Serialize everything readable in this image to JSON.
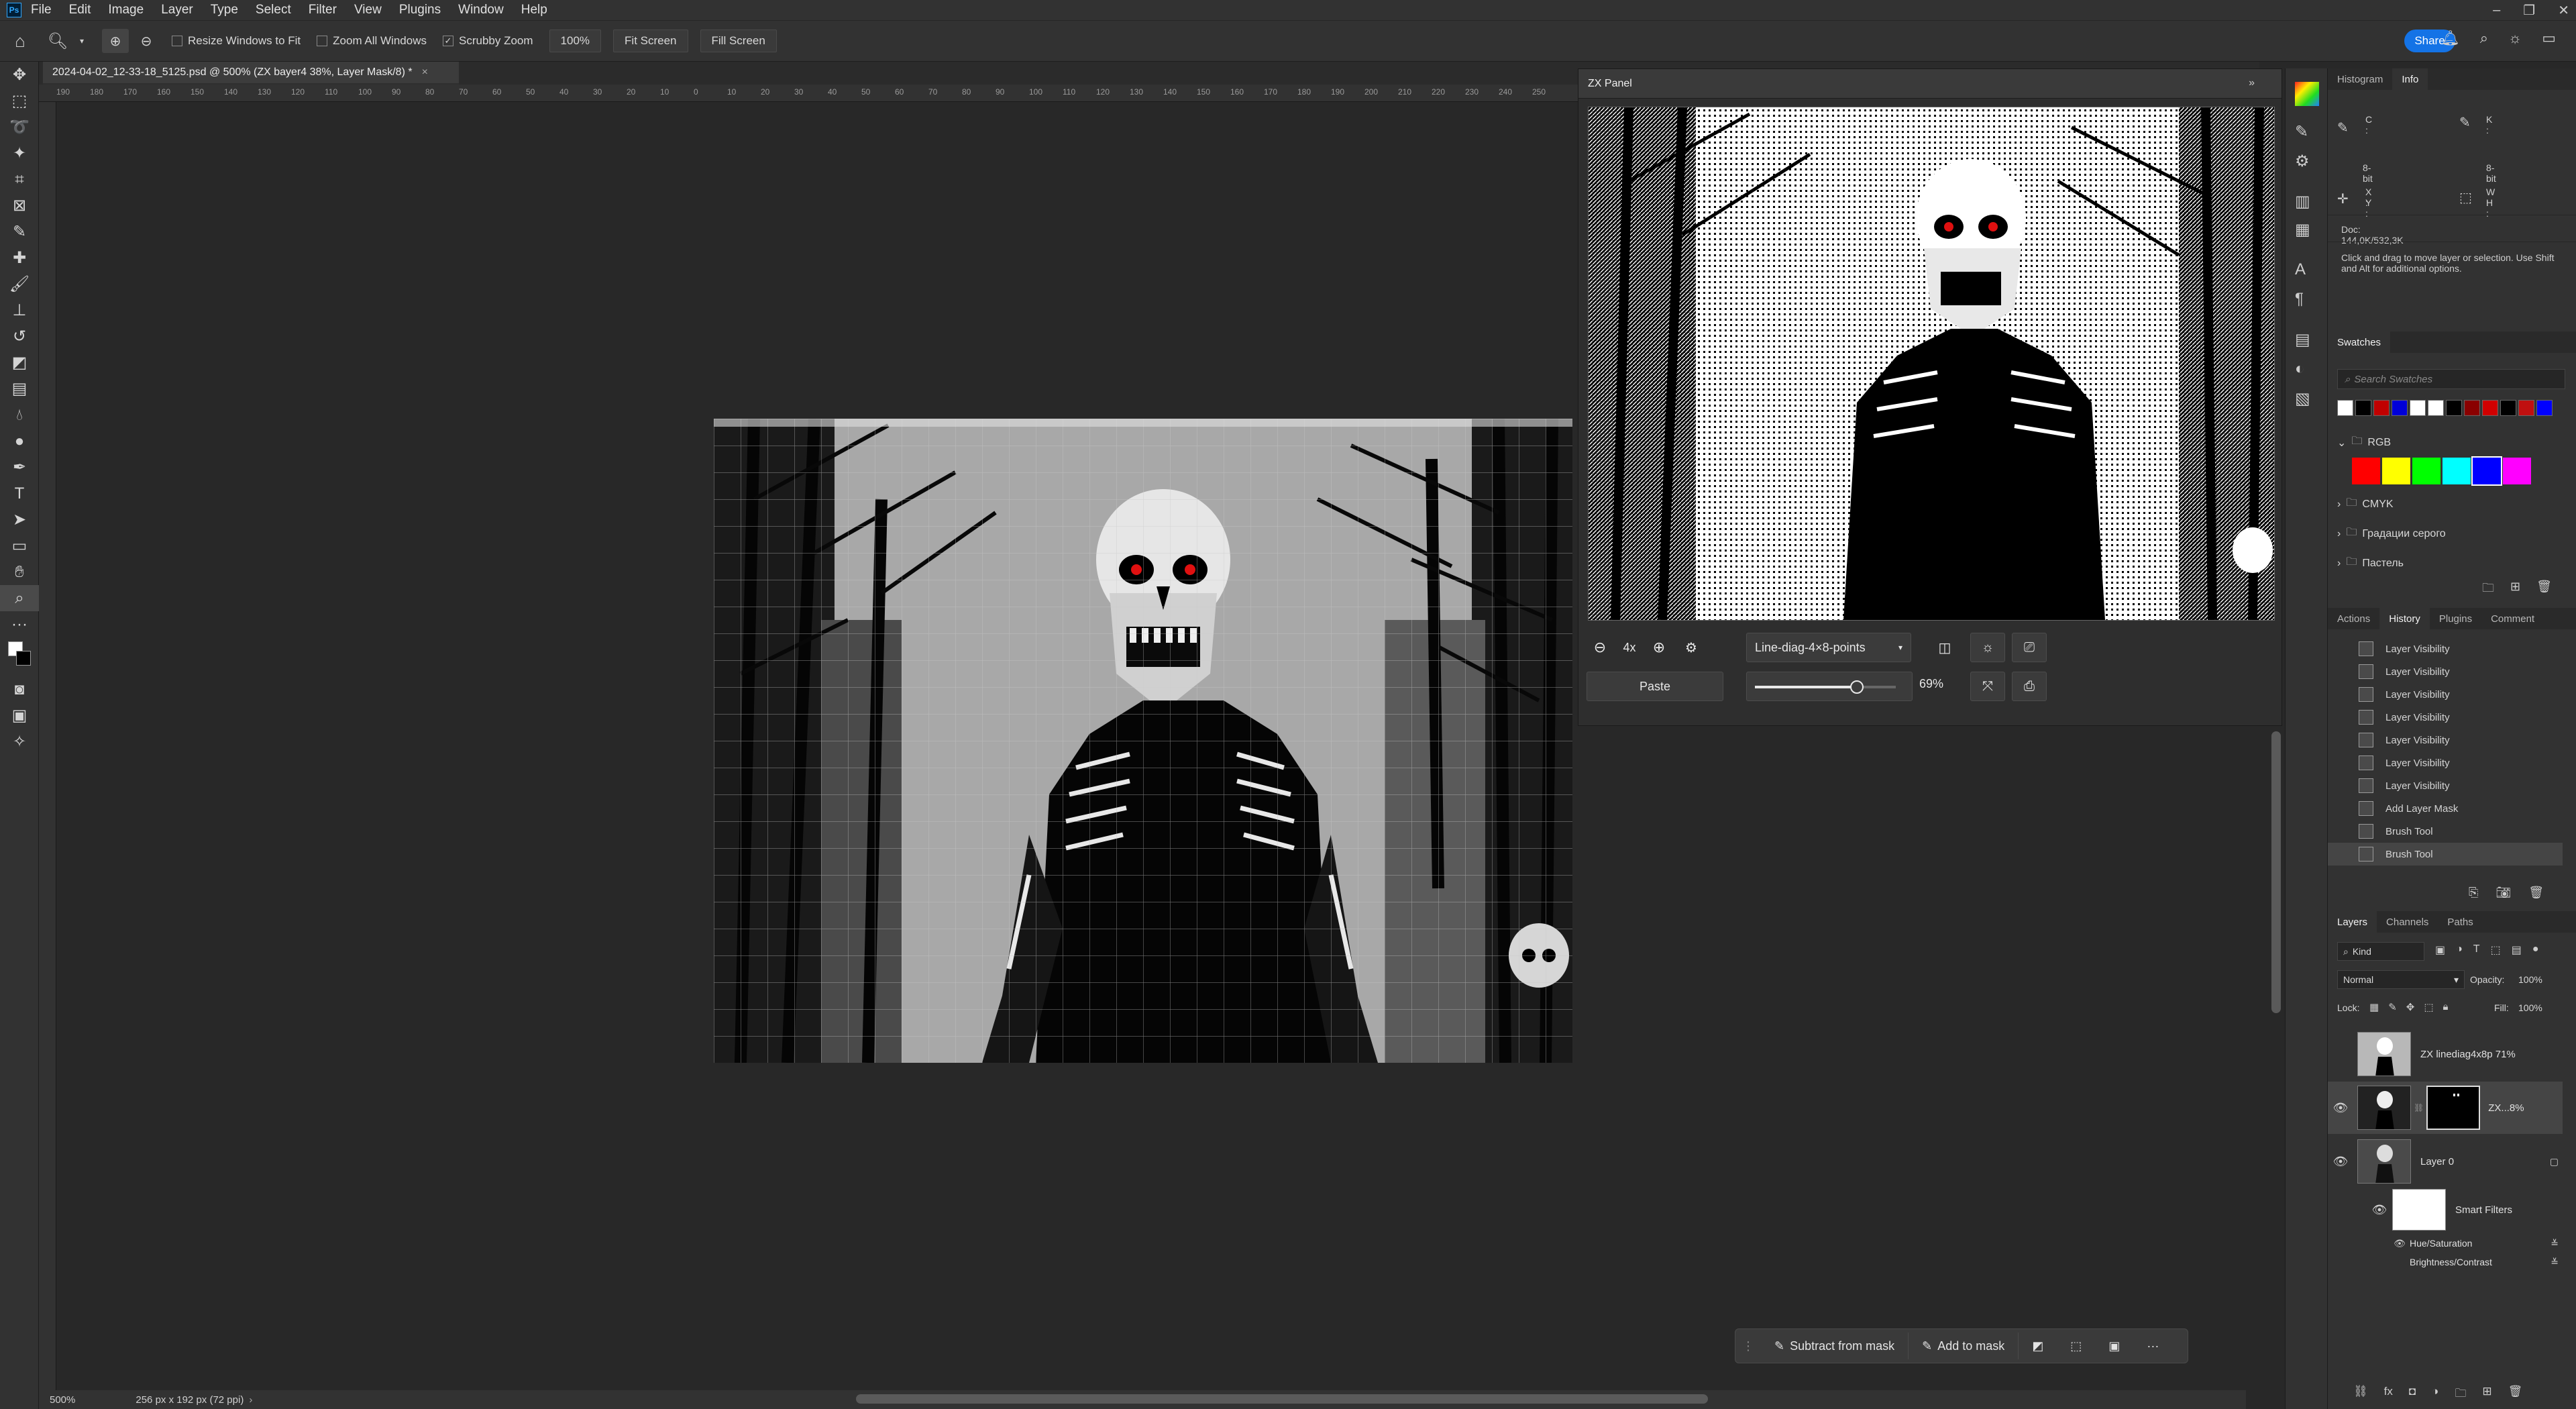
{
  "menubar": {
    "logo": "Ps",
    "items": [
      "File",
      "Edit",
      "Image",
      "Layer",
      "Type",
      "Select",
      "Filter",
      "View",
      "Plugins",
      "Window",
      "Help"
    ]
  },
  "window_controls": {
    "minimize": "–",
    "restore": "❐",
    "close": "✕"
  },
  "options_bar": {
    "resize_windows_label": "Resize Windows to Fit",
    "zoom_all_windows_label": "Zoom All Windows",
    "scrubby_zoom_label": "Scrubby Zoom",
    "zoom_value": "100%",
    "fit_screen_label": "Fit Screen",
    "fill_screen_label": "Fill Screen",
    "share_label": "Share"
  },
  "document": {
    "tab_title": "2024-04-02_12-33-18_5125.psd @ 500% (ZX bayer4 38%, Layer Mask/8) *",
    "tab_close": "×",
    "ruler_ticks": [
      "190",
      "180",
      "170",
      "160",
      "150",
      "140",
      "130",
      "120",
      "110",
      "100",
      "90",
      "80",
      "70",
      "60",
      "50",
      "40",
      "30",
      "20",
      "10",
      "0",
      "10",
      "20",
      "30",
      "40",
      "50",
      "60",
      "70",
      "80",
      "90",
      "100",
      "110",
      "120",
      "130",
      "140",
      "150",
      "160",
      "170",
      "180",
      "190",
      "200",
      "210",
      "220",
      "230",
      "240",
      "250"
    ],
    "status_zoom": "500%",
    "status_info": "256 px x 192 px (72 ppi)"
  },
  "zx_panel": {
    "title": "ZX Panel",
    "zoom_level": "4x",
    "dither_select": "Line-diag-4×8-points",
    "paste_label": "Paste",
    "slider_value": "69%",
    "slider_fraction": 0.69
  },
  "info_panel": {
    "tabs": [
      "Histogram",
      "Info"
    ],
    "active_tab": "Info",
    "c_label": "C :",
    "k_label": "K :",
    "bit_left": "8-bit",
    "bit_right": "8-bit",
    "x_label": "X :",
    "y_label": "Y :",
    "w_label": "W :",
    "h_label": "H :",
    "doc_size": "Doc: 144,0K/532,3K",
    "hint": "Click and drag to move layer or selection.  Use Shift and Alt for additional options."
  },
  "swatches_panel": {
    "title": "Swatches",
    "search_placeholder": "Search Swatches",
    "recent_colors": [
      "#ffffff",
      "#000000",
      "#c00000",
      "#0000d8",
      "#ffffff",
      "#ffffff",
      "#000000",
      "#8a0000",
      "#d00000",
      "#000000",
      "#c01010",
      "#0000ff"
    ],
    "groups": [
      {
        "name": "RGB",
        "expanded": true,
        "colors": [
          "#ff0000",
          "#ffff00",
          "#00ff00",
          "#00ffff",
          "#0000ff",
          "#ff00ff"
        ]
      },
      {
        "name": "CMYK",
        "expanded": false
      },
      {
        "name": "Градации серого",
        "expanded": false
      },
      {
        "name": "Пастель",
        "expanded": false
      }
    ]
  },
  "history_panel": {
    "tabs": [
      "Actions",
      "History",
      "Plugins",
      "Comment"
    ],
    "active_tab": "History",
    "items": [
      "Layer Visibility",
      "Layer Visibility",
      "Layer Visibility",
      "Layer Visibility",
      "Layer Visibility",
      "Layer Visibility",
      "Layer Visibility",
      "Add Layer Mask",
      "Brush Tool",
      "Brush Tool"
    ]
  },
  "layers_panel": {
    "tabs": [
      "Layers",
      "Channels",
      "Paths"
    ],
    "active_tab": "Layers",
    "filter_kind": "Kind",
    "blend_mode": "Normal",
    "opacity_label": "Opacity:",
    "opacity_value": "100%",
    "lock_label": "Lock:",
    "fill_label": "Fill:",
    "fill_value": "100%",
    "layers": [
      {
        "name": "ZX linediag4x8p 71%",
        "visible": false
      },
      {
        "name": "ZX...8%",
        "visible": true
      },
      {
        "name": "Layer 0",
        "visible": true
      }
    ],
    "smart_filters_label": "Smart Filters",
    "filters": [
      "Hue/Saturation",
      "Brightness/Contrast"
    ]
  },
  "floating_bar": {
    "subtract_label": "Subtract from mask",
    "add_label": "Add to mask",
    "more": "···"
  }
}
